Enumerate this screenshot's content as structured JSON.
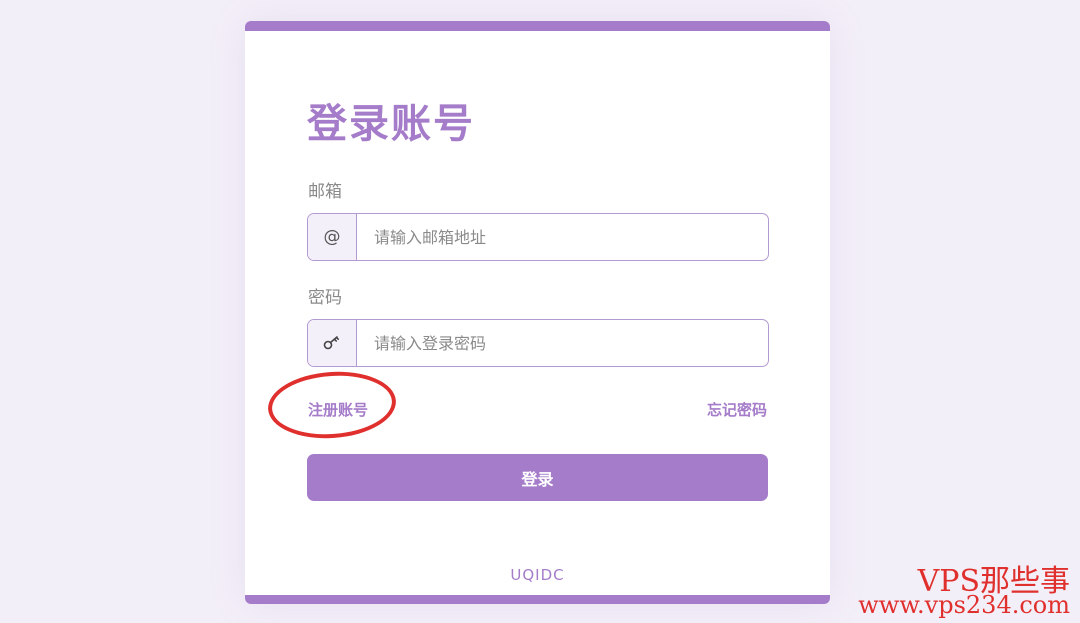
{
  "login": {
    "title": "登录账号",
    "email": {
      "label": "邮箱",
      "icon": "@",
      "icon_name": "at-icon",
      "placeholder": "请输入邮箱地址",
      "value": ""
    },
    "password": {
      "label": "密码",
      "icon_name": "key-icon",
      "placeholder": "请输入登录密码",
      "value": ""
    },
    "register_link": "注册账号",
    "forgot_link": "忘记密码",
    "submit_label": "登录",
    "footer_brand": "UQIDC"
  },
  "watermark": {
    "line1": "VPS那些事",
    "line2": "www.vps234.com"
  },
  "colors": {
    "accent": "#a57cc9",
    "page_background": "#f3eff8",
    "annotation": "#e0302e"
  }
}
